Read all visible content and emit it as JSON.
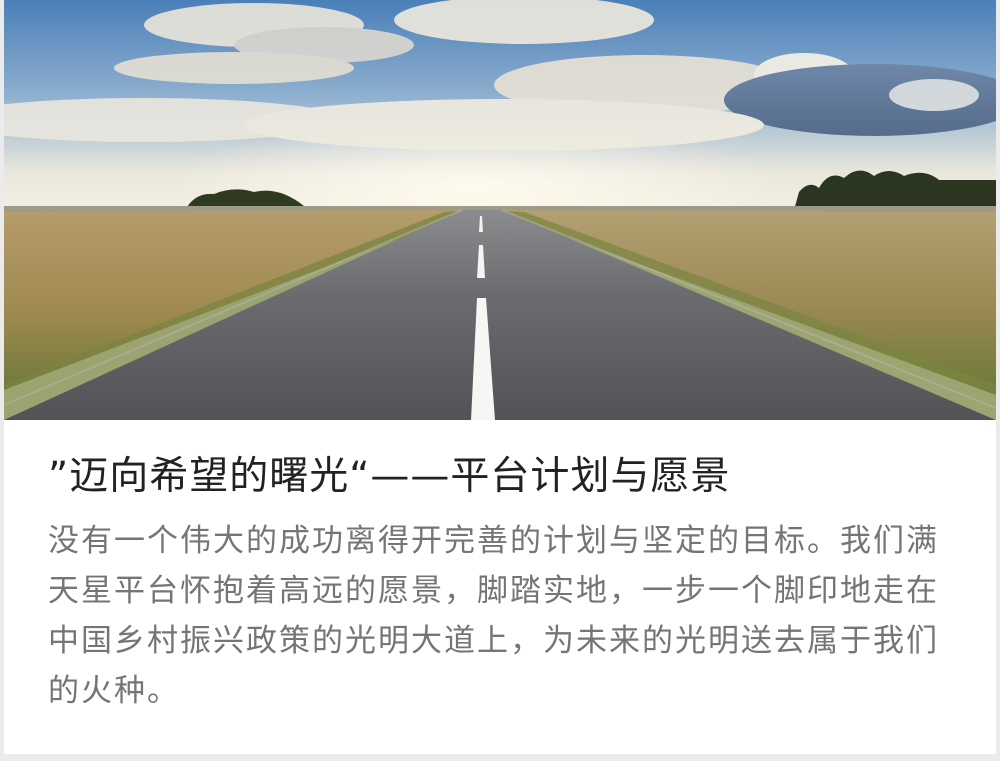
{
  "hero_image": {
    "icon": "road-landscape-image"
  },
  "article": {
    "title": "”迈向希望的曙光“——平台计划与愿景",
    "body": "没有一个伟大的成功离得开完善的计划与坚定的目标。我们满天星平台怀抱着高远的愿景，脚踏实地，一步一个脚印地走在中国乡村振兴政策的光明大道上，为未来的光明送去属于我们的火种。"
  },
  "colors": {
    "sky_top": "#4a7fb8",
    "sky_horizon": "#f1ede0",
    "road": "#57595c",
    "grass": "#a18d52",
    "title": "#222222",
    "body": "#757575",
    "background": "#ebebeb"
  }
}
